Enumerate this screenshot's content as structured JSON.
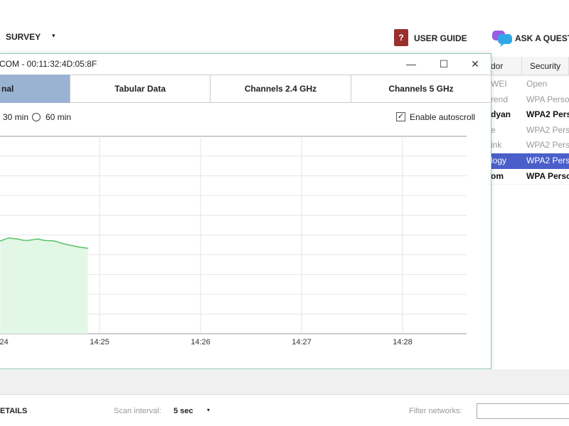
{
  "toolbar": {
    "survey_label": "SURVEY",
    "caret": "▾",
    "user_guide_label": "USER GUIDE",
    "user_guide_icon_glyph": "?",
    "ask_label": "ASK A QUESTI"
  },
  "background_table": {
    "columns": [
      "dor",
      "Security"
    ],
    "rows": [
      {
        "vendor": "WEI",
        "security": "Open",
        "style": "dim"
      },
      {
        "vendor": "rend",
        "security": "WPA Perso",
        "style": "dim"
      },
      {
        "vendor": "dyan",
        "security": "WPA2 Perso",
        "style": "bold"
      },
      {
        "vendor": "e",
        "security": "WPA2 Perso",
        "style": "dim"
      },
      {
        "vendor": "ink",
        "security": "WPA2 Perso",
        "style": "dim"
      },
      {
        "vendor": "logy",
        "security": "WPA2 Perso",
        "style": "sel"
      },
      {
        "vendor": "om",
        "security": "WPA Perso",
        "style": "bold"
      }
    ]
  },
  "dialog": {
    "title": "COM - 00:11:32:4D:05:8F",
    "controls": {
      "minimize": "—",
      "maximize": "☐",
      "close": "✕"
    },
    "tabs": [
      {
        "label": "nal",
        "active": true
      },
      {
        "label": "Tabular Data"
      },
      {
        "label": "Channels 2.4 GHz"
      },
      {
        "label": "Channels 5 GHz"
      }
    ],
    "time_options": [
      {
        "label": "30 min",
        "selected": false
      },
      {
        "label": "60 min",
        "selected": false
      }
    ],
    "autoscroll": {
      "label": "Enable autoscroll",
      "checked": true
    }
  },
  "chart_data": {
    "type": "area",
    "x_ticks": [
      "14:24",
      "14:25",
      "14:26",
      "14:27",
      "14:28"
    ],
    "xlim": [
      "14:24:00",
      "14:28:37"
    ],
    "ylim": [
      0,
      10
    ],
    "y_gridlines": 10,
    "grid": true,
    "line_color": "#5cc46e",
    "fill_color": "#e3f7e6",
    "x": [
      "14:24:01",
      "14:24:06",
      "14:24:11",
      "14:24:15",
      "14:24:18",
      "14:24:23",
      "14:24:27",
      "14:24:33",
      "14:24:39",
      "14:24:47",
      "14:24:53"
    ],
    "values": [
      4.7,
      4.85,
      4.8,
      4.73,
      4.73,
      4.8,
      4.73,
      4.7,
      4.55,
      4.4,
      4.33
    ]
  },
  "footer": {
    "details_label": "ETAILS",
    "scan_interval_label": "Scan interval:",
    "scan_interval_value": "5 sec",
    "filter_label": "Filter networks:",
    "filter_value": ""
  }
}
